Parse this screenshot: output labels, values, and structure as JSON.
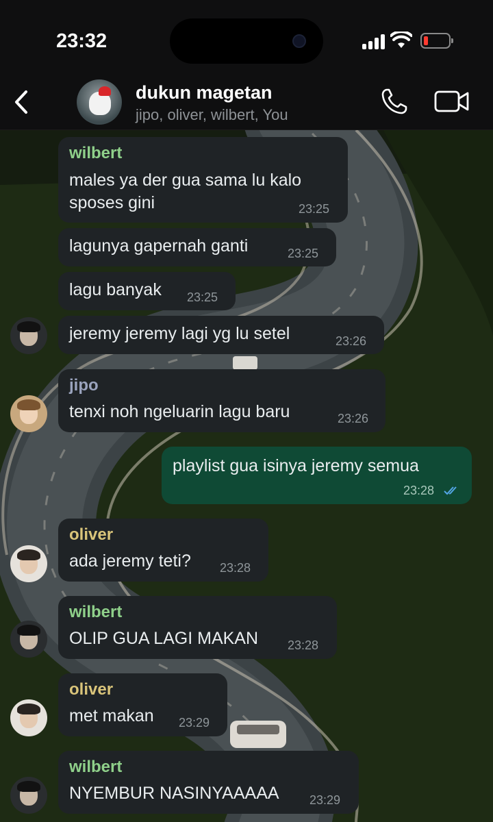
{
  "status_bar": {
    "time": "23:32"
  },
  "header": {
    "title": "dukun magetan",
    "subtitle": "jipo, oliver, wilbert, You"
  },
  "colors": {
    "wilbert": "#8fd08a",
    "jipo": "#9aa3bd",
    "oliver": "#d9c47a",
    "outgoing_bubble": "#0f4a35",
    "incoming_bubble": "#1f2326",
    "read_ticks": "#53a6e6"
  },
  "messages": [
    {
      "sender": "wilbert",
      "text": "males ya der gua sama lu kalo\nsposes gini",
      "time": "23:25"
    },
    {
      "text": "lagunya gapernah ganti",
      "time": "23:25"
    },
    {
      "text": "lagu banyak",
      "time": "23:25"
    },
    {
      "text": "jeremy jeremy lagi yg lu setel",
      "time": "23:26"
    },
    {
      "sender": "jipo",
      "text": "tenxi noh ngeluarin lagu baru",
      "time": "23:26"
    },
    {
      "text": "playlist gua isinya jeremy semua",
      "time": "23:28",
      "outgoing": true,
      "status": "read"
    },
    {
      "sender": "oliver",
      "text": "ada jeremy teti?",
      "time": "23:28"
    },
    {
      "sender": "wilbert",
      "text": "OLIP GUA LAGI MAKAN",
      "time": "23:28"
    },
    {
      "sender": "oliver",
      "text": "met makan",
      "time": "23:29"
    },
    {
      "sender": "wilbert",
      "text": "NYEMBUR NASINYAAAAA",
      "time": "23:29"
    }
  ]
}
